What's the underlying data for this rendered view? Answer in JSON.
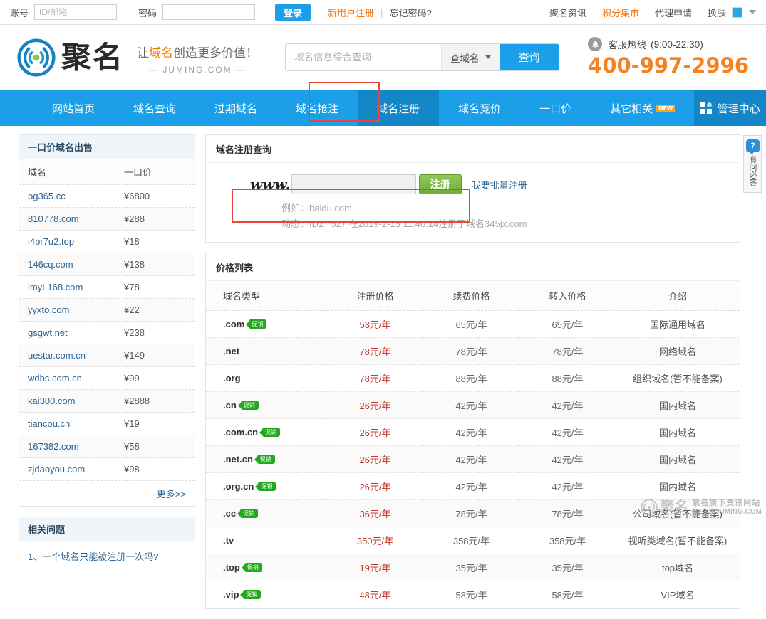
{
  "topbar": {
    "account_label": "账号",
    "account_placeholder": "ID/邮箱",
    "account_value": "",
    "password_label": "密码",
    "password_value": "",
    "login_button": "登录",
    "register_link": "新用户注册",
    "separator": "|",
    "forgot_link": "忘记密码?",
    "links": [
      {
        "label": "聚名资讯",
        "highlight": false
      },
      {
        "label": "积分集市",
        "highlight": true
      },
      {
        "label": "代理申请",
        "highlight": false
      },
      {
        "label": "换肤",
        "highlight": false
      }
    ],
    "skin_color": "#22a7f0"
  },
  "header": {
    "logo_text": "聚名",
    "slogan_prefix": "让",
    "slogan_highlight": "域名",
    "slogan_suffix": "创造更多价值！",
    "slogan_domain": "JUMING.COM",
    "dash": "—",
    "search_placeholder": "域名信息综合查询",
    "search_value": "",
    "search_category": "查域名",
    "search_button": "查询",
    "hotline_label": "客服热线",
    "hotline_hours": "(9:00-22:30)",
    "hotline_number": "400-997-2996",
    "hotline_color": "#f58220"
  },
  "nav": {
    "items": [
      {
        "label": "网站首页",
        "active": false,
        "badge": ""
      },
      {
        "label": "域名查询",
        "active": false,
        "badge": ""
      },
      {
        "label": "过期域名",
        "active": false,
        "badge": ""
      },
      {
        "label": "域名抢注",
        "active": false,
        "badge": ""
      },
      {
        "label": "域名注册",
        "active": true,
        "badge": ""
      },
      {
        "label": "域名竞价",
        "active": false,
        "badge": ""
      },
      {
        "label": "一口价",
        "active": false,
        "badge": ""
      },
      {
        "label": "其它相关",
        "active": false,
        "badge": "NEW"
      }
    ],
    "admin_label": "管理中心",
    "accent": "#1a9fe8",
    "highlight_color": "#e8453c"
  },
  "sidebar": {
    "sale_panel": {
      "title": "一口价域名出售",
      "col_domain": "域名",
      "col_price": "一口价",
      "rows": [
        {
          "domain": "pg365.cc",
          "price": "¥6800"
        },
        {
          "domain": "810778.com",
          "price": "¥288"
        },
        {
          "domain": "i4br7u2.top",
          "price": "¥18"
        },
        {
          "domain": "146cq.com",
          "price": "¥138"
        },
        {
          "domain": "imyL168.com",
          "price": "¥78"
        },
        {
          "domain": "yyxto.com",
          "price": "¥22"
        },
        {
          "domain": "gsgwt.net",
          "price": "¥238"
        },
        {
          "domain": "uestar.com.cn",
          "price": "¥149"
        },
        {
          "domain": "wdbs.com.cn",
          "price": "¥99"
        },
        {
          "domain": "kai300.com",
          "price": "¥2888"
        },
        {
          "domain": "tiancou.cn",
          "price": "¥19"
        },
        {
          "domain": "167382.com",
          "price": "¥58"
        },
        {
          "domain": "zjdaoyou.com",
          "price": "¥98"
        }
      ],
      "more_label": "更多>>"
    },
    "faq_panel": {
      "title": "相关问题",
      "items": [
        "1、一个域名只能被注册一次吗?"
      ]
    }
  },
  "main": {
    "register_card": {
      "title": "域名注册查询",
      "www_prefix": "www.",
      "input_value": "",
      "input_placeholder": "",
      "register_button": "注册",
      "batch_link": "我要批量注册",
      "example_hint": "例如：baidu.com",
      "activity_hint": "动态：ID2**527 在2019-2-13 11:40:14注册了域名345jx.com"
    },
    "price_card": {
      "title": "价格列表",
      "columns": [
        "域名类型",
        "注册价格",
        "续费价格",
        "转入价格",
        "介绍"
      ],
      "promo_badge": "促销",
      "rows": [
        {
          "type": ".com",
          "promo": true,
          "reg": "53元/年",
          "renew": "65元/年",
          "transfer": "65元/年",
          "desc": "国际通用域名"
        },
        {
          "type": ".net",
          "promo": false,
          "reg": "78元/年",
          "renew": "78元/年",
          "transfer": "78元/年",
          "desc": "网络域名"
        },
        {
          "type": ".org",
          "promo": false,
          "reg": "78元/年",
          "renew": "88元/年",
          "transfer": "88元/年",
          "desc": "组织域名(暂不能备案)"
        },
        {
          "type": ".cn",
          "promo": true,
          "reg": "26元/年",
          "renew": "42元/年",
          "transfer": "42元/年",
          "desc": "国内域名"
        },
        {
          "type": ".com.cn",
          "promo": true,
          "reg": "26元/年",
          "renew": "42元/年",
          "transfer": "42元/年",
          "desc": "国内域名"
        },
        {
          "type": ".net.cn",
          "promo": true,
          "reg": "26元/年",
          "renew": "42元/年",
          "transfer": "42元/年",
          "desc": "国内域名"
        },
        {
          "type": ".org.cn",
          "promo": true,
          "reg": "26元/年",
          "renew": "42元/年",
          "transfer": "42元/年",
          "desc": "国内域名"
        },
        {
          "type": ".cc",
          "promo": true,
          "reg": "36元/年",
          "renew": "78元/年",
          "transfer": "78元/年",
          "desc": "公司域名(暂不能备案)"
        },
        {
          "type": ".tv",
          "promo": false,
          "reg": "350元/年",
          "renew": "358元/年",
          "transfer": "358元/年",
          "desc": "视听类域名(暂不能备案)"
        },
        {
          "type": ".top",
          "promo": true,
          "reg": "19元/年",
          "renew": "35元/年",
          "transfer": "35元/年",
          "desc": "top域名"
        },
        {
          "type": ".vip",
          "promo": true,
          "reg": "48元/年",
          "renew": "58元/年",
          "transfer": "58元/年",
          "desc": "VIP域名"
        }
      ]
    }
  },
  "ask_widget": {
    "icon": "?",
    "label": "有问必答"
  },
  "watermark": {
    "logo_text": "聚名",
    "line1": "聚名旗下资讯网站",
    "line2": "NEWS.JUMING.COM"
  }
}
